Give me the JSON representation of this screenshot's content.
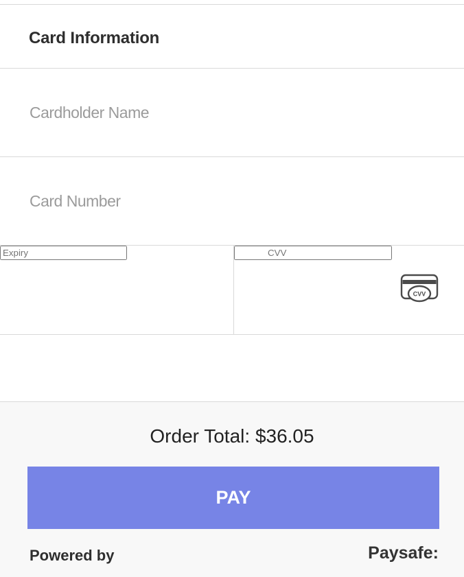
{
  "card_form": {
    "title": "Card Information",
    "cardholder_name": {
      "value": "",
      "placeholder": "Cardholder Name"
    },
    "card_number": {
      "value": "",
      "placeholder": "Card Number"
    },
    "expiry": {
      "value": "",
      "placeholder": "Expiry"
    },
    "cvv": {
      "value": "",
      "placeholder": "CVV",
      "icon": "cvv-card-icon",
      "icon_text": "CVV"
    }
  },
  "footer": {
    "order_total": "Order Total: $36.05",
    "pay_label": "PAY",
    "powered_by": "Powered by",
    "brand": "Paysafe:"
  },
  "colors": {
    "pay_button": "#7784e6",
    "divider": "#d9d9d9",
    "footer_bg": "#f8f8f8",
    "placeholder": "#9b9b9b"
  }
}
